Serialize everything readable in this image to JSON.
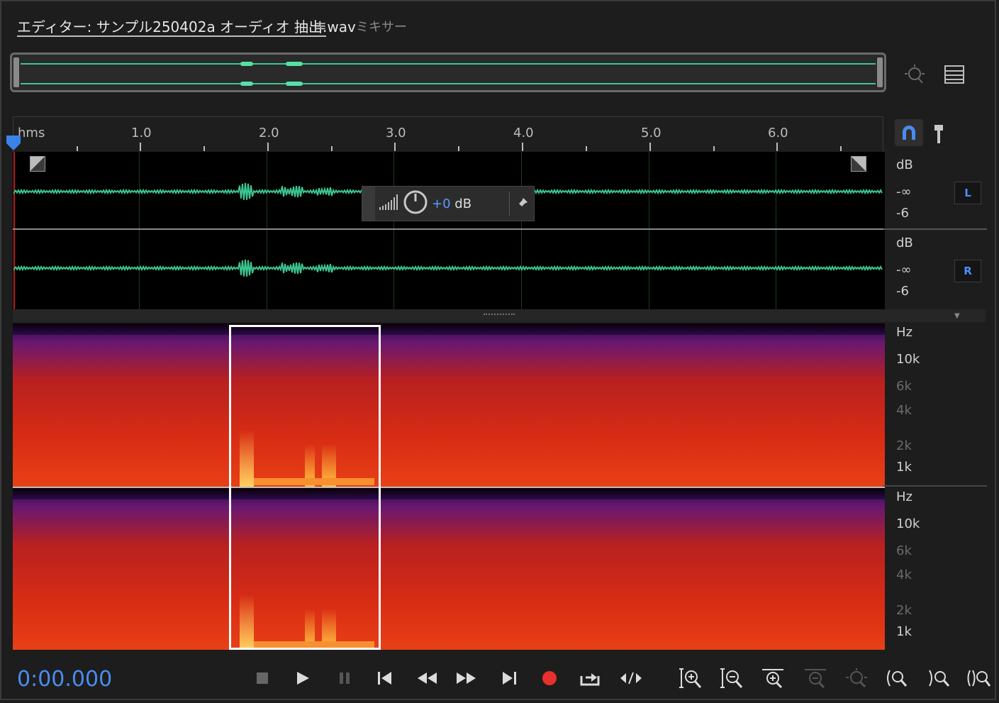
{
  "tabs": {
    "editor_label": "エディター: サンプル250402a オーディオ 抽出.wav",
    "menu_glyph": "≡",
    "mixer_label": "ミキサー"
  },
  "ruler": {
    "unit": "hms",
    "labels": [
      "1.0",
      "2.0",
      "3.0",
      "4.0",
      "5.0",
      "6.0"
    ]
  },
  "hud": {
    "prefix": "+0",
    "unit": "dB"
  },
  "amplitude_scale": {
    "left": {
      "unit": "dB",
      "top": "-∞",
      "bottom": "-6",
      "channel": "L"
    },
    "right": {
      "unit": "dB",
      "top": "-∞",
      "bottom": "-6",
      "channel": "R"
    }
  },
  "frequency_scale": {
    "unit": "Hz",
    "labels": [
      "10k",
      "6k",
      "4k",
      "2k",
      "1k"
    ]
  },
  "transport": {
    "time": "0:00.000"
  },
  "colors": {
    "waveform": "#3ec690",
    "accent": "#4a8cf0",
    "record": "#e8302c",
    "selection": "#ffffff"
  },
  "icons": [
    "zoom-selection-icon",
    "panel-list-icon",
    "magnet-icon",
    "marker-pin-icon",
    "stop-icon",
    "play-icon",
    "pause-icon",
    "go-to-start-icon",
    "rewind-icon",
    "fast-forward-icon",
    "go-to-end-icon",
    "record-icon",
    "loop-icon",
    "skip-selection-icon",
    "zoom-in-amplitude-icon",
    "zoom-out-amplitude-icon",
    "zoom-in-time-icon",
    "zoom-out-time-icon",
    "zoom-full-icon",
    "zoom-in-point-icon",
    "zoom-out-point-icon",
    "zoom-selection-point-icon"
  ]
}
